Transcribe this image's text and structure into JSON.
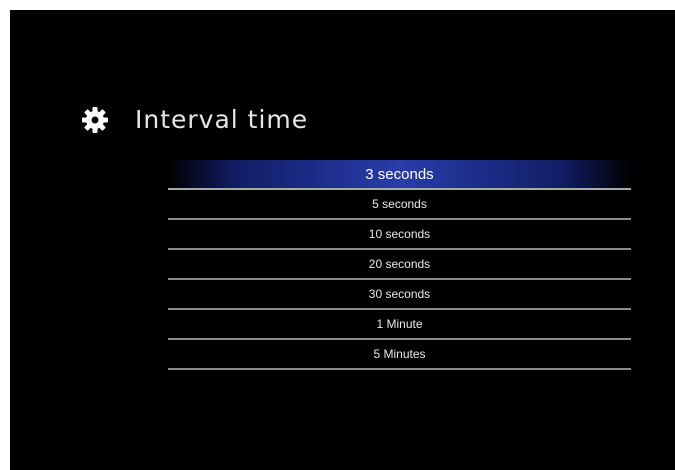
{
  "header": {
    "title": "Interval time",
    "icon": "gear-icon"
  },
  "menu": {
    "items": [
      {
        "label": "3 seconds",
        "selected": true
      },
      {
        "label": "5 seconds"
      },
      {
        "label": "10 seconds"
      },
      {
        "label": "20 seconds"
      },
      {
        "label": "30 seconds"
      },
      {
        "label": "1 Minute"
      },
      {
        "label": "5 Minutes"
      }
    ]
  },
  "colors": {
    "background": "#000000",
    "highlight": "#283caa",
    "text": "#eaeaea",
    "divider": "#8a8a8a"
  }
}
